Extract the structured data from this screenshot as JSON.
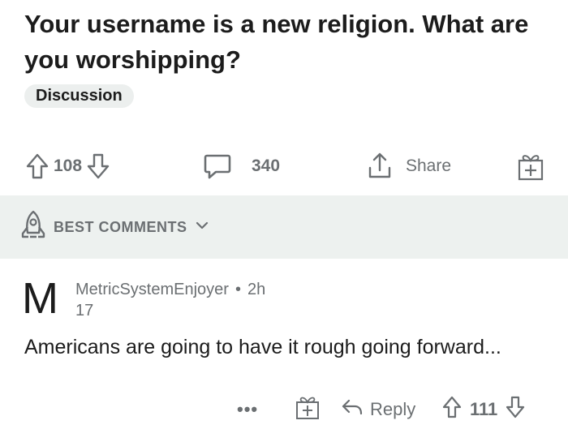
{
  "post": {
    "title": "Your username is a new religion. What are you worshipping?",
    "flair": "Discussion"
  },
  "actions": {
    "upvote_icon": "arrow-up-icon",
    "score": "108",
    "downvote_icon": "arrow-down-icon",
    "comment_icon": "speech-bubble-icon",
    "comment_count": "340",
    "share_icon": "share-icon",
    "share_label": "Share",
    "award_icon": "gift-icon"
  },
  "sort": {
    "icon": "rocket-icon",
    "label": "BEST COMMENTS",
    "chevron_icon": "chevron-down-icon"
  },
  "comment": {
    "avatar_letter": "M",
    "author": "MetricSystemEnjoyer",
    "separator": "•",
    "age": "2h",
    "karma": "17",
    "body": "Americans are going to have it rough going forward...",
    "more_label": "•••",
    "award_icon": "gift-icon",
    "reply_label": "Reply",
    "reply_icon": "reply-arrow-icon",
    "score": "111"
  },
  "colors": {
    "text_primary": "#1c1c1c",
    "text_secondary": "#6b6f72",
    "flair_bg": "#ecefee",
    "sort_bar_bg": "#edf1ef",
    "background": "#ffffff"
  }
}
